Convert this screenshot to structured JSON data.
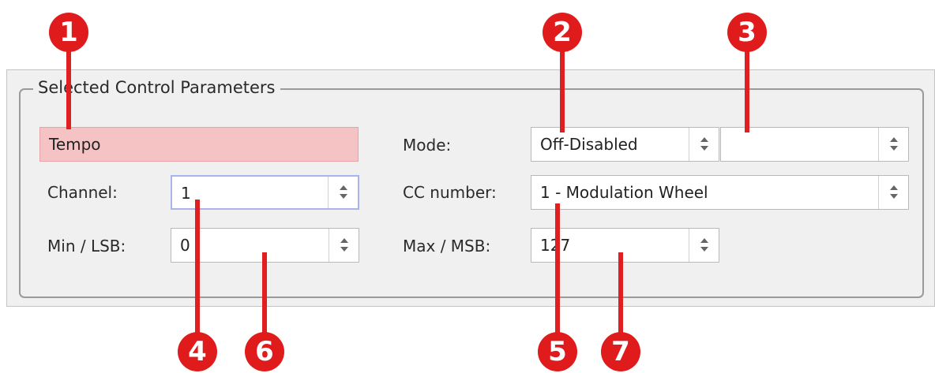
{
  "group_title": "Selected Control Parameters",
  "control_name": "Tempo",
  "labels": {
    "mode": "Mode:",
    "channel": "Channel:",
    "cc_number": "CC number:",
    "min_lsb": "Min / LSB:",
    "max_msb": "Max / MSB:"
  },
  "values": {
    "mode": "Off-Disabled",
    "mode_sub": "",
    "channel": "1",
    "cc_number": "1 - Modulation Wheel",
    "min_lsb": "0",
    "max_msb": "127"
  },
  "callouts": [
    "1",
    "2",
    "3",
    "4",
    "5",
    "6",
    "7"
  ],
  "colors": {
    "callout": "#e01b1b",
    "name_field_bg": "#f6c3c5",
    "focus_border": "#a9b4ee"
  }
}
